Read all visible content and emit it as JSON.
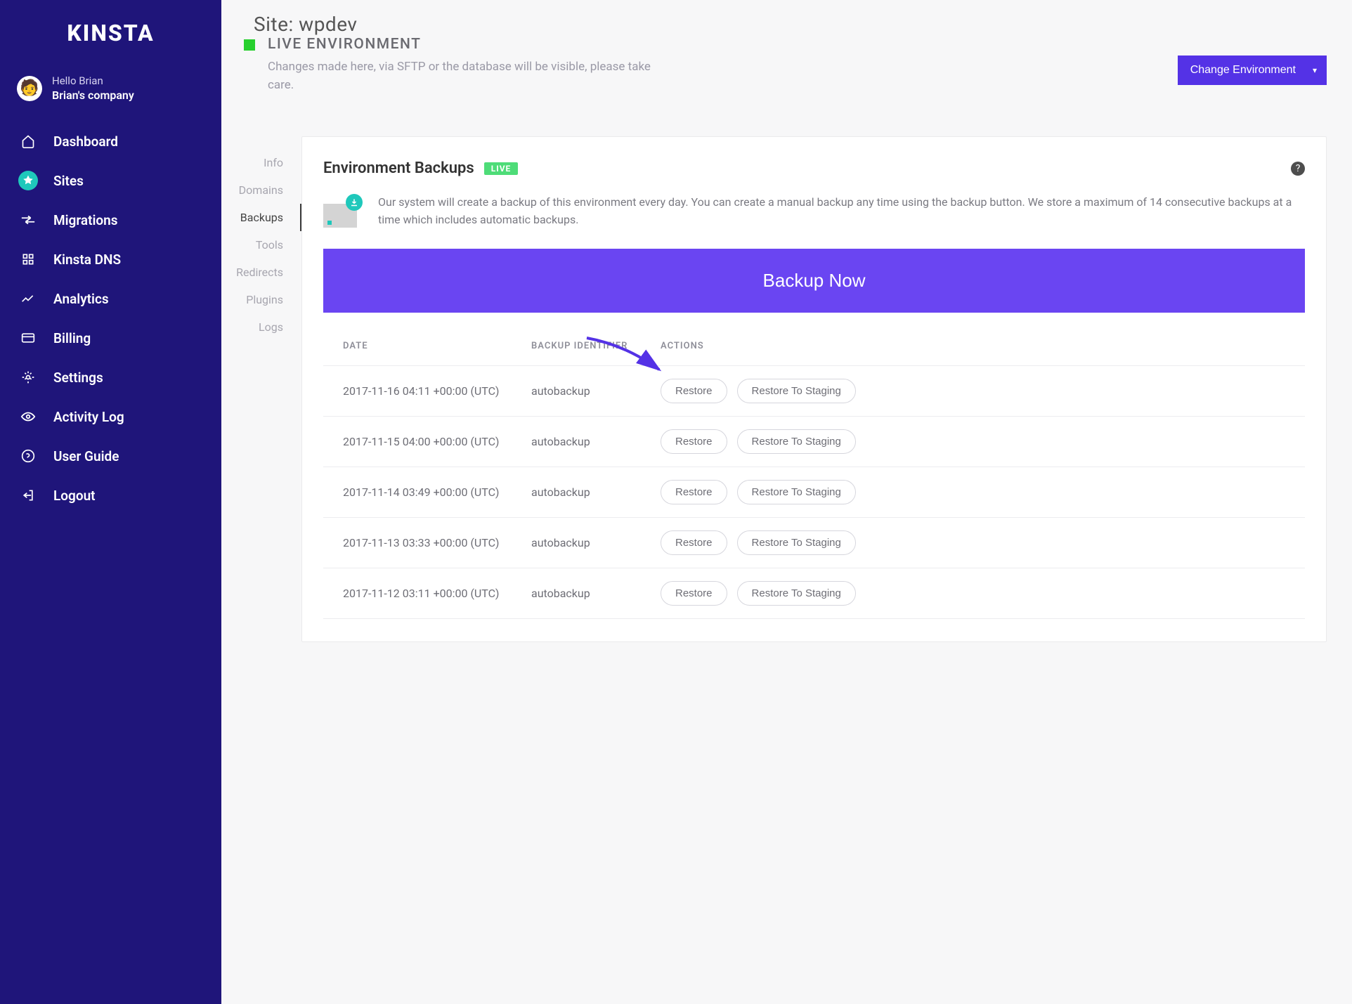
{
  "brand": "KINSTA",
  "user": {
    "hello": "Hello Brian",
    "company": "Brian's company"
  },
  "nav": {
    "items": [
      {
        "label": "Dashboard",
        "icon": "home"
      },
      {
        "label": "Sites",
        "icon": "sites",
        "active": true
      },
      {
        "label": "Migrations",
        "icon": "migrations"
      },
      {
        "label": "Kinsta DNS",
        "icon": "dns"
      },
      {
        "label": "Analytics",
        "icon": "analytics"
      },
      {
        "label": "Billing",
        "icon": "billing"
      },
      {
        "label": "Settings",
        "icon": "settings"
      },
      {
        "label": "Activity Log",
        "icon": "activity"
      },
      {
        "label": "User Guide",
        "icon": "guide"
      },
      {
        "label": "Logout",
        "icon": "logout"
      }
    ]
  },
  "page": {
    "title": "Site: wpdev"
  },
  "subnav": {
    "items": [
      {
        "label": "Info"
      },
      {
        "label": "Domains"
      },
      {
        "label": "Backups",
        "active": true
      },
      {
        "label": "Tools"
      },
      {
        "label": "Redirects"
      },
      {
        "label": "Plugins"
      },
      {
        "label": "Logs"
      }
    ]
  },
  "env": {
    "title": "LIVE ENVIRONMENT",
    "desc": "Changes made here, via SFTP or the database will be visible, please take care.",
    "change_label": "Change Environment"
  },
  "card": {
    "title": "Environment Backups",
    "badge": "LIVE",
    "info": "Our system will create a backup of this environment every day. You can create a manual backup any time using the backup button. We store a maximum of 14 consecutive backups at a time which includes automatic backups.",
    "backup_now": "Backup Now"
  },
  "table": {
    "headers": {
      "date": "DATE",
      "id": "BACKUP IDENTIFIER",
      "actions": "ACTIONS"
    },
    "restore_label": "Restore",
    "staging_label": "Restore To Staging",
    "rows": [
      {
        "date": "2017-11-16 04:11 +00:00 (UTC)",
        "id": "autobackup"
      },
      {
        "date": "2017-11-15 04:00 +00:00 (UTC)",
        "id": "autobackup"
      },
      {
        "date": "2017-11-14 03:49 +00:00 (UTC)",
        "id": "autobackup"
      },
      {
        "date": "2017-11-13 03:33 +00:00 (UTC)",
        "id": "autobackup"
      },
      {
        "date": "2017-11-12 03:11 +00:00 (UTC)",
        "id": "autobackup"
      }
    ]
  },
  "colors": {
    "brand_bg": "#1f157a",
    "accent": "#6a45f2",
    "teal": "#1fc8bb",
    "green": "#27d02e"
  }
}
